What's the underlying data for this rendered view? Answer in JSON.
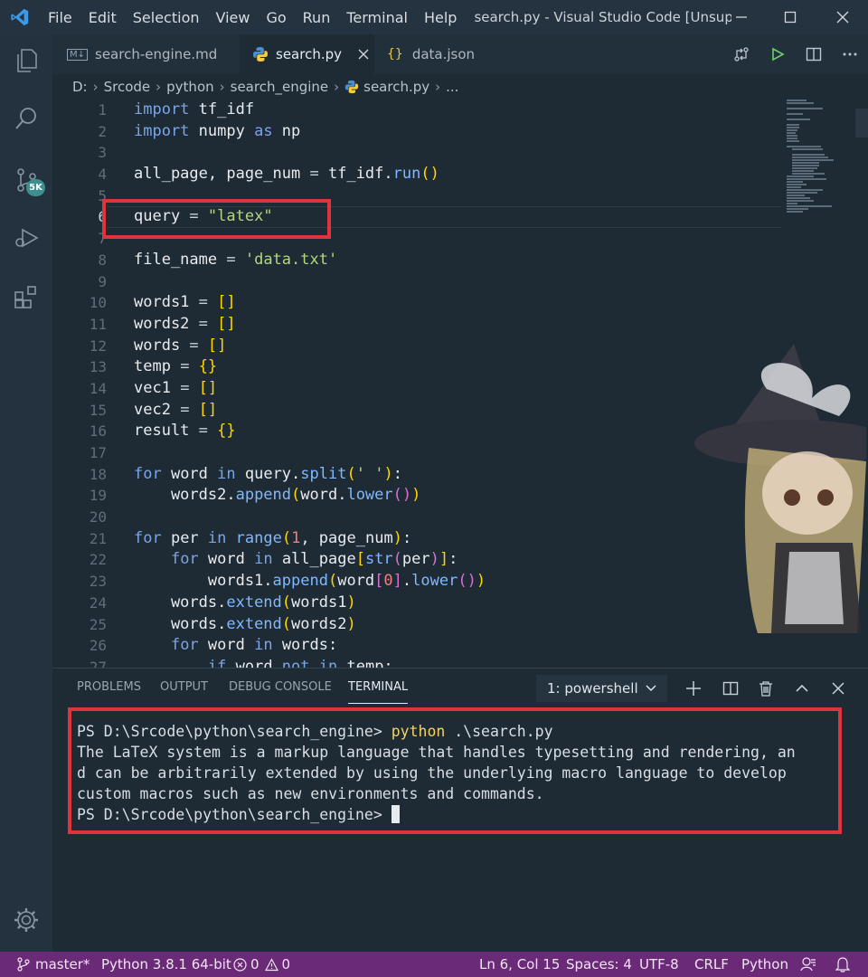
{
  "window": {
    "menu": [
      "File",
      "Edit",
      "Selection",
      "View",
      "Go",
      "Run",
      "Terminal",
      "Help"
    ],
    "title": "search.py - Visual Studio Code [Unsupp..."
  },
  "activity_bar": {
    "scm_badge": "5K"
  },
  "tabs": [
    {
      "label": "search-engine.md",
      "icon": "markdown-icon",
      "icon_text": "M↓"
    },
    {
      "label": "search.py",
      "icon": "python-icon"
    },
    {
      "label": "data.json",
      "icon": "json-icon",
      "icon_text": "{}"
    }
  ],
  "breadcrumb": [
    "D:",
    "Srcode",
    "python",
    "search_engine",
    "search.py",
    "..."
  ],
  "line_numbers": [
    "1",
    "2",
    "3",
    "4",
    "5",
    "6",
    "7",
    "8",
    "9",
    "10",
    "11",
    "12",
    "13",
    "14",
    "15",
    "16",
    "17",
    "18",
    "19",
    "20",
    "21",
    "22",
    "23",
    "24",
    "25",
    "26",
    "27"
  ],
  "panel": {
    "tabs": [
      "PROBLEMS",
      "OUTPUT",
      "DEBUG CONSOLE",
      "TERMINAL"
    ],
    "terminal_select": "1: powershell",
    "terminal": {
      "prompt": "PS D:\\Srcode\\python\\search_engine>",
      "command": "python",
      "command_arg": ".\\search.py",
      "output": [
        "The LaTeX system is a markup language that handles typesetting and rendering, an",
        "d can be arbitrarily extended by using the underlying macro language to develop",
        "custom macros such as new environments and commands."
      ]
    }
  },
  "status_bar": {
    "branch": "master*",
    "interpreter": "Python 3.8.1 64-bit",
    "errors": "0",
    "warnings": "0",
    "position": "Ln 6, Col 15",
    "spaces": "Spaces: 4",
    "encoding": "UTF-8",
    "eol": "CRLF",
    "language": "Python"
  },
  "colors": {
    "accent_red": "#e0343a",
    "status_bar": "#6a2a78",
    "keyword": "#7aa6e8",
    "string": "#b5d57e"
  }
}
